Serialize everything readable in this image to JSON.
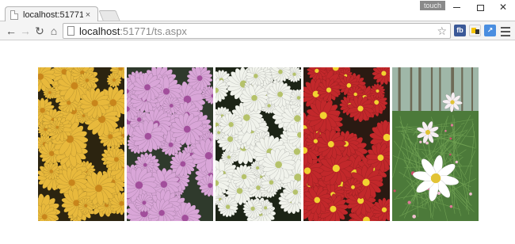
{
  "browser": {
    "tab": {
      "title": "localhost:51771/ts.aspx",
      "close_glyph": "×"
    },
    "touch_badge": "touch",
    "window_controls": {
      "close_glyph": "✕"
    },
    "nav": {
      "back_glyph": "←",
      "forward_glyph": "→",
      "reload_glyph": "↻",
      "home_glyph": "⌂"
    },
    "omnibox": {
      "url_host": "localhost",
      "url_rest": ":51771/ts.aspx",
      "star_glyph": "☆"
    },
    "extensions": [
      {
        "name": "facebook-extension-icon",
        "label": "fb",
        "color": "#3b5998"
      },
      {
        "name": "note-extension-icon",
        "label": ""
      },
      {
        "name": "chart-extension-icon",
        "label": "↗",
        "color": "#4a8ee0"
      }
    ]
  },
  "gallery": {
    "photos": [
      {
        "name": "photo-yellow-chrysanthemums",
        "subject": "yellow-chrysanthemums",
        "colors": {
          "bg": "#2c2410",
          "petal": "#e8b93c",
          "center": "#c9861b"
        }
      },
      {
        "name": "photo-purple-chrysanthemums",
        "subject": "purple-chrysanthemums",
        "colors": {
          "bg": "#2f3a2c",
          "petal": "#d9a6d8",
          "center": "#a24e9c"
        }
      },
      {
        "name": "photo-white-chrysanthemums",
        "subject": "white-chrysanthemums",
        "colors": {
          "bg": "#1c2416",
          "petal": "#f1f3ec",
          "center": "#b5c26a"
        }
      },
      {
        "name": "photo-red-chrysanthemums",
        "subject": "red-chrysanthemums",
        "colors": {
          "bg": "#2a1a12",
          "petal": "#c2282b",
          "center": "#f2d230"
        }
      },
      {
        "name": "photo-white-cosmos-garden",
        "subject": "white-cosmos-garden",
        "colors": {
          "bg": "#4c7a3a",
          "petal": "#ffffff",
          "center": "#e2c335"
        }
      }
    ]
  }
}
